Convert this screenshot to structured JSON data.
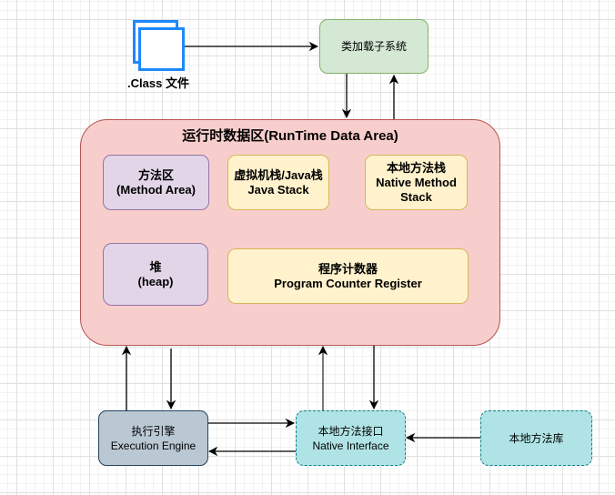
{
  "class_file": {
    "label": ".Class 文件",
    "icon": "file-stack-icon"
  },
  "class_loader": {
    "label": "类加载子系统"
  },
  "runtime_area": {
    "title": "运行时数据区(RunTime Data Area)",
    "method_area": {
      "line1": "方法区",
      "line2": "(Method Area)"
    },
    "java_stack": {
      "line1": "虚拟机栈/Java栈",
      "line2": "Java Stack"
    },
    "native_stack": {
      "line1": "本地方法栈",
      "line2": "Native Method",
      "line3": "Stack"
    },
    "heap": {
      "line1": "堆",
      "line2": "(heap)"
    },
    "pc_register": {
      "line1": "程序计数器",
      "line2": "Program Counter Register"
    }
  },
  "execution_engine": {
    "line1": "执行引擎",
    "line2": "Execution Engine"
  },
  "native_interface": {
    "line1": "本地方法接口",
    "line2": "Native Interface"
  },
  "native_library": {
    "label": "本地方法库"
  },
  "colors": {
    "class_file_border": "#1e88ff",
    "class_loader_fill": "#d5e8d4",
    "class_loader_border": "#82b366",
    "runtime_fill": "#f8cecc",
    "runtime_border": "#b85450",
    "purple_fill": "#e1d5e7",
    "purple_border": "#9673a6",
    "yellow_fill": "#fff2cc",
    "yellow_border": "#d6b656",
    "engine_fill": "#bac8d3",
    "engine_border": "#23445d",
    "cyan_fill": "#b0e3e6",
    "cyan_border": "#0e8088"
  }
}
